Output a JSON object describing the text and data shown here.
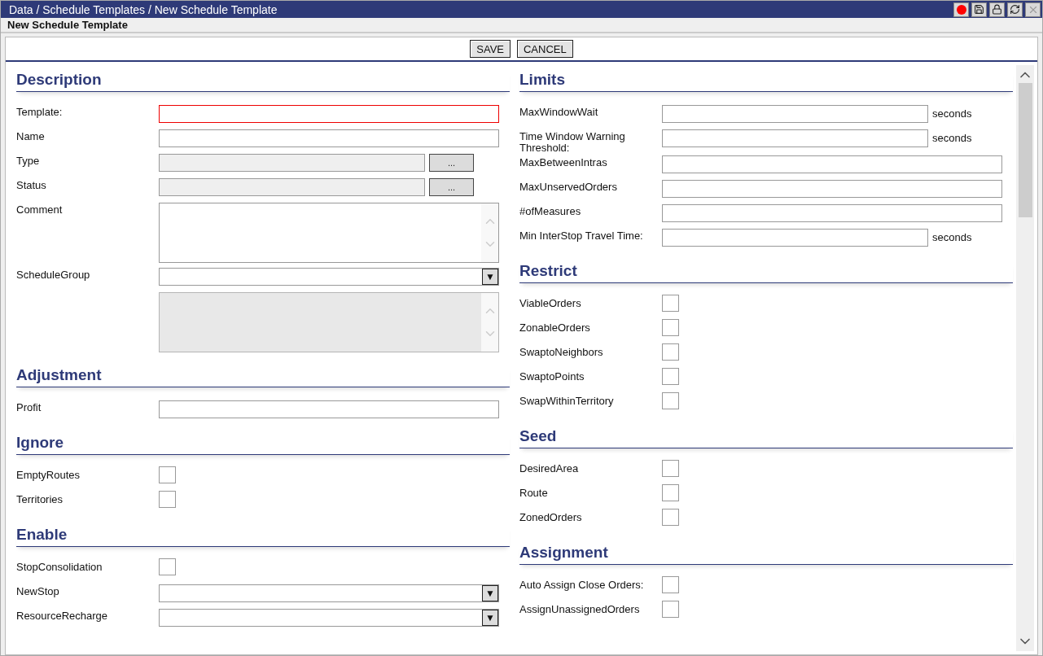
{
  "window": {
    "title": "Data / Schedule Templates / New Schedule Template"
  },
  "title_buttons": [
    {
      "kind": "record"
    },
    {
      "kind": "save"
    },
    {
      "kind": "lock"
    },
    {
      "kind": "refresh"
    },
    {
      "kind": "close",
      "disabled": true
    }
  ],
  "subtitle": "New Schedule Template",
  "toolbar": {
    "buttons": [
      "SAVE",
      "CANCEL"
    ]
  },
  "columns": [
    [
      {
        "title": "Description",
        "fields": [
          {
            "label": "Template:",
            "kind": "text",
            "invalid": true
          },
          {
            "label": "Name",
            "kind": "text",
            "invalid": false
          },
          {
            "label": "Type",
            "kind": "lookup",
            "button": "...",
            "disabled": true
          },
          {
            "label": "Status",
            "kind": "lookup",
            "button": "...",
            "disabled": true
          },
          {
            "label": "Comment",
            "kind": "textarea",
            "disabled": false
          },
          {
            "label": "ScheduleGroup",
            "kind": "select",
            "arrow": "▼"
          },
          {
            "kind": "textarea",
            "disabled": true
          }
        ]
      },
      {
        "title": "Adjustment",
        "fields": [
          {
            "label": "Profit",
            "kind": "text",
            "invalid": false
          }
        ]
      },
      {
        "title": "Ignore",
        "fields": [
          {
            "label": "EmptyRoutes",
            "kind": "checkbox",
            "checked": false
          },
          {
            "label": "Territories",
            "kind": "checkbox",
            "checked": false
          }
        ]
      },
      {
        "title": "Enable",
        "fields": [
          {
            "label": "StopConsolidation",
            "kind": "checkbox",
            "checked": false
          },
          {
            "label": "NewStop",
            "kind": "select",
            "arrow": "▼"
          },
          {
            "label": "ResourceRecharge",
            "kind": "select",
            "arrow": "▼"
          }
        ]
      }
    ],
    [
      {
        "title": "Limits",
        "fields": [
          {
            "label": "MaxWindowWait",
            "kind": "text",
            "invalid": false,
            "unit": "seconds"
          },
          {
            "label": "Time Window Warning Threshold:",
            "kind": "text",
            "invalid": false,
            "unit": "seconds"
          },
          {
            "label": "MaxBetweenIntras",
            "kind": "text",
            "invalid": false
          },
          {
            "label": "MaxUnservedOrders",
            "kind": "text",
            "invalid": false
          },
          {
            "label": "#ofMeasures",
            "kind": "text",
            "invalid": false
          },
          {
            "label": "Min InterStop Travel Time:",
            "kind": "text",
            "invalid": false,
            "unit": "seconds"
          }
        ]
      },
      {
        "title": "Restrict",
        "fields": [
          {
            "label": "ViableOrders",
            "kind": "checkbox",
            "checked": false
          },
          {
            "label": "ZonableOrders",
            "kind": "checkbox",
            "checked": false
          },
          {
            "label": "SwaptoNeighbors",
            "kind": "checkbox",
            "checked": false
          },
          {
            "label": "SwaptoPoints",
            "kind": "checkbox",
            "checked": false
          },
          {
            "label": "SwapWithinTerritory",
            "kind": "checkbox",
            "checked": false
          }
        ]
      },
      {
        "title": "Seed",
        "fields": [
          {
            "label": "DesiredArea",
            "kind": "checkbox",
            "checked": false
          },
          {
            "label": "Route",
            "kind": "checkbox",
            "checked": false
          },
          {
            "label": "ZonedOrders",
            "kind": "checkbox",
            "checked": false
          }
        ]
      },
      {
        "title": "Assignment",
        "fields": [
          {
            "label": "Auto Assign Close Orders:",
            "kind": "checkbox",
            "checked": false
          },
          {
            "label": "AssignUnassignedOrders",
            "kind": "checkbox",
            "checked": false
          }
        ]
      }
    ]
  ]
}
